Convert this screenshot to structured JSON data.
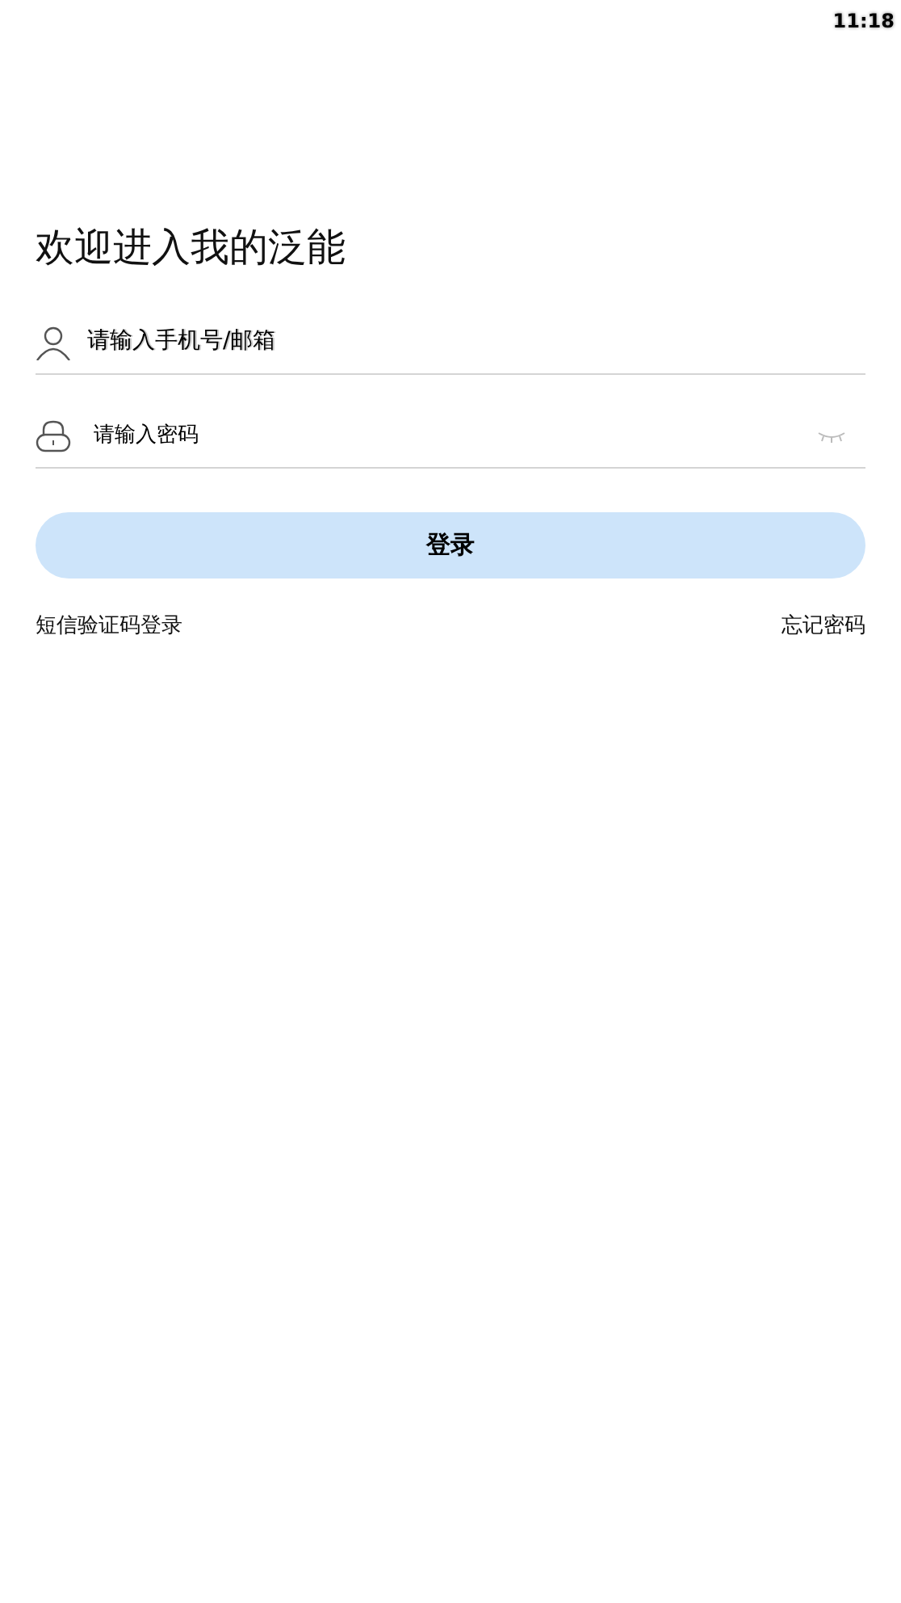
{
  "status_bar": {
    "time": "11:18"
  },
  "title": "欢迎进入我的泛能",
  "account_field": {
    "placeholder": "请输入手机号/邮箱"
  },
  "password_field": {
    "placeholder": "请输入密码",
    "password_visible": false
  },
  "login_button": {
    "label": "登录",
    "disabled": true
  },
  "links": {
    "sms_login": "短信验证码登录",
    "forgot_password": "忘记密码"
  }
}
